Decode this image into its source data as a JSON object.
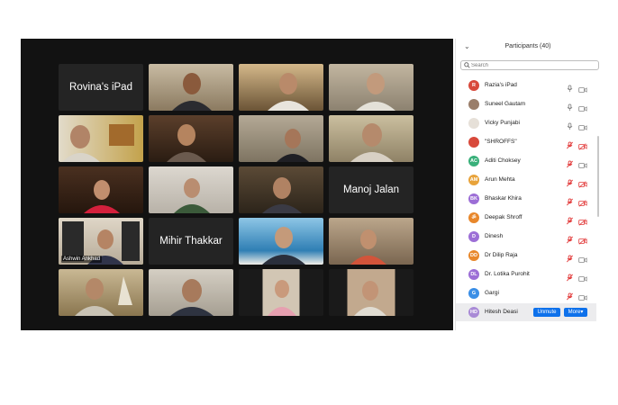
{
  "panel": {
    "title": "Participants (40)",
    "search_placeholder": "Search",
    "participants": [
      {
        "name": "Razia's iPad",
        "initials": "R",
        "avatar_color": "#d8493b",
        "mic": "on",
        "cam": "on"
      },
      {
        "name": "Suneel Gautam",
        "initials": "",
        "avatar_color": "#9a7e6a",
        "mic": "on",
        "cam": "on"
      },
      {
        "name": "Vicky Punjabi",
        "initials": "",
        "avatar_color": "#e6e0d8",
        "mic": "on",
        "cam": "on"
      },
      {
        "name": "\"SHROFFS\"",
        "initials": "",
        "avatar_color": "#d8493b",
        "mic": "muted",
        "cam": "off"
      },
      {
        "name": "Aditi Choksey",
        "initials": "AC",
        "avatar_color": "#39b07a",
        "mic": "muted",
        "cam": "on"
      },
      {
        "name": "Arun Mehta",
        "initials": "AM",
        "avatar_color": "#e8a33b",
        "mic": "muted",
        "cam": "off"
      },
      {
        "name": "Bhaskar Khira",
        "initials": "BK",
        "avatar_color": "#9c6ed6",
        "mic": "muted",
        "cam": "off"
      },
      {
        "name": "Deepak Shroff",
        "initials": "ॐ",
        "avatar_color": "#e8872b",
        "mic": "muted",
        "cam": "off"
      },
      {
        "name": "Dinesh",
        "initials": "D",
        "avatar_color": "#9c6ed6",
        "mic": "muted",
        "cam": "off"
      },
      {
        "name": "Dr Dilip Raja",
        "initials": "DD",
        "avatar_color": "#e8872b",
        "mic": "muted",
        "cam": "on"
      },
      {
        "name": "Dr. Lotika Purohit",
        "initials": "DL",
        "avatar_color": "#9c6ed6",
        "mic": "muted",
        "cam": "on"
      },
      {
        "name": "Gargi",
        "initials": "G",
        "avatar_color": "#3a8ee6",
        "mic": "muted",
        "cam": "on"
      },
      {
        "name": "Hitesh Deasi",
        "initials": "HD",
        "avatar_color": "#a98ad6",
        "mic": "",
        "cam": ""
      }
    ],
    "unmute_label": "Unmute",
    "more_label": "More▾"
  },
  "gallery": {
    "tile_names": [
      "Rovina's iPad",
      "Manoj Jalan",
      "Mihir Thakkar"
    ],
    "active_caption": "Ashwin Ankhad"
  },
  "colors": {
    "gallery_bg": "#121212",
    "active_border": "#c9df5a",
    "accent_blue": "#0e71eb",
    "muted_red": "#e23b3b"
  }
}
